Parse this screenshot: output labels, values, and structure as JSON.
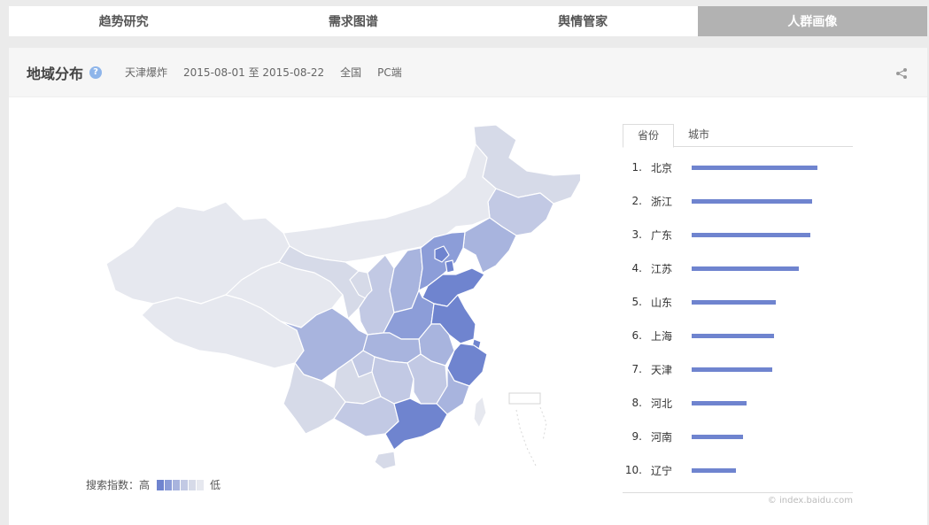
{
  "topnav": {
    "tabs": [
      {
        "label": "趋势研究"
      },
      {
        "label": "需求图谱"
      },
      {
        "label": "舆情管家"
      },
      {
        "label": "人群画像"
      }
    ]
  },
  "panel": {
    "title": "地域分布",
    "help_icon": "?",
    "keyword": "天津爆炸",
    "date_range": "2015-08-01 至 2015-08-22",
    "region": "全国",
    "device": "PC端",
    "share_icon": "share-icon"
  },
  "legend": {
    "label": "搜索指数：高",
    "low_label": "低",
    "colors": [
      "#6f84cf",
      "#8c9dd8",
      "#a8b4de",
      "#c2c9e4",
      "#d6dae8",
      "#e6e8ef"
    ]
  },
  "ranking": {
    "tabs": [
      {
        "label": "省份"
      },
      {
        "label": "城市"
      }
    ],
    "items": [
      {
        "idx": "1.",
        "name": "北京",
        "value": 100
      },
      {
        "idx": "2.",
        "name": "浙江",
        "value": 95.8
      },
      {
        "idx": "3.",
        "name": "广东",
        "value": 94.4
      },
      {
        "idx": "4.",
        "name": "江苏",
        "value": 85.3
      },
      {
        "idx": "5.",
        "name": "山东",
        "value": 66.9
      },
      {
        "idx": "6.",
        "name": "上海",
        "value": 65.5
      },
      {
        "idx": "7.",
        "name": "天津",
        "value": 64.1
      },
      {
        "idx": "8.",
        "name": "河北",
        "value": 43.7
      },
      {
        "idx": "9.",
        "name": "河南",
        "value": 40.8
      },
      {
        "idx": "10.",
        "name": "辽宁",
        "value": 35.2
      }
    ],
    "bar_color": "#6f84cf"
  },
  "watermark": "© index.baidu.com"
}
